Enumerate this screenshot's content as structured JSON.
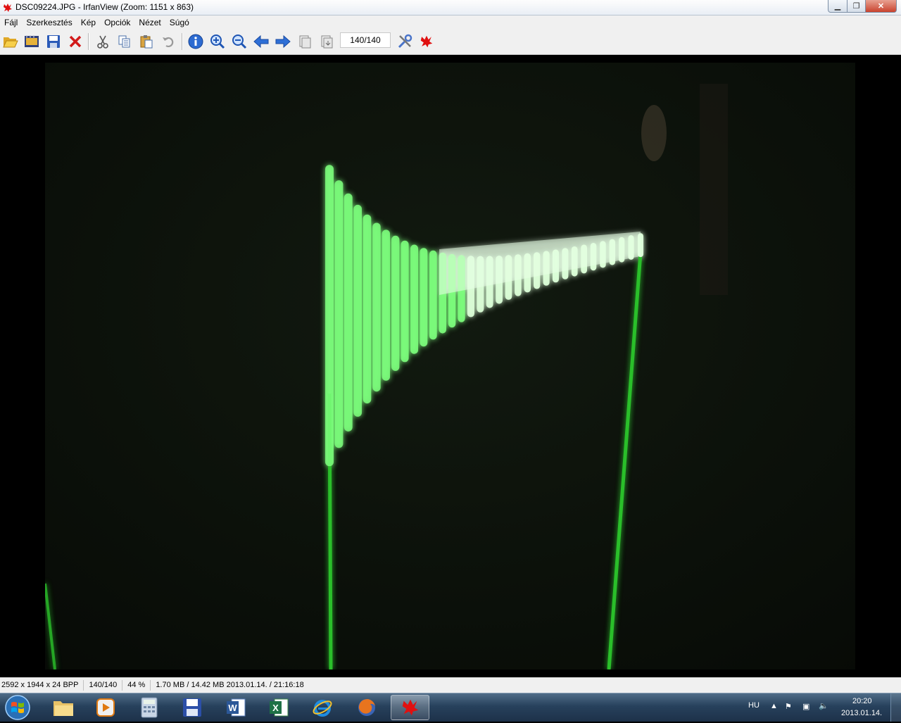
{
  "window": {
    "title": "DSC09224.JPG - IrfanView (Zoom: 1151 x 863)",
    "icon": "irfanview-cat-icon"
  },
  "menu": [
    "Fájl",
    "Szerkesztés",
    "Kép",
    "Opciók",
    "Nézet",
    "Súgó"
  ],
  "toolbar": {
    "buttons": [
      "open-folder-icon",
      "thumbnails-icon",
      "save-icon",
      "delete-icon",
      "cut-icon",
      "copy-icon",
      "paste-icon",
      "undo-icon",
      "info-icon",
      "zoom-in-icon",
      "zoom-out-icon",
      "previous-icon",
      "next-icon",
      "first-page-icon",
      "last-page-icon",
      "settings-icon",
      "irfanview-cat-icon"
    ],
    "page_counter": "140/140"
  },
  "statusbar": {
    "dimensions": "2592 x 1944 x 24 BPP",
    "index": "140/140",
    "zoom": "44 %",
    "size_date": "1.70 MB / 14.42 MB 2013.01.14. / 21:16:18"
  },
  "taskbar": {
    "apps": [
      "windows-start-icon",
      "explorer-folder-icon",
      "media-player-icon",
      "calculator-icon",
      "floppy-save-icon",
      "word-icon",
      "excel-icon",
      "internet-explorer-icon",
      "firefox-icon",
      "irfanview-cat-icon"
    ],
    "language": "HU",
    "time": "20:20",
    "date": "2013.01.14."
  },
  "colors": {
    "trace": "#7dff7d",
    "trace_glow": "#2bbf2b",
    "photo_bg": "#0c120a"
  }
}
